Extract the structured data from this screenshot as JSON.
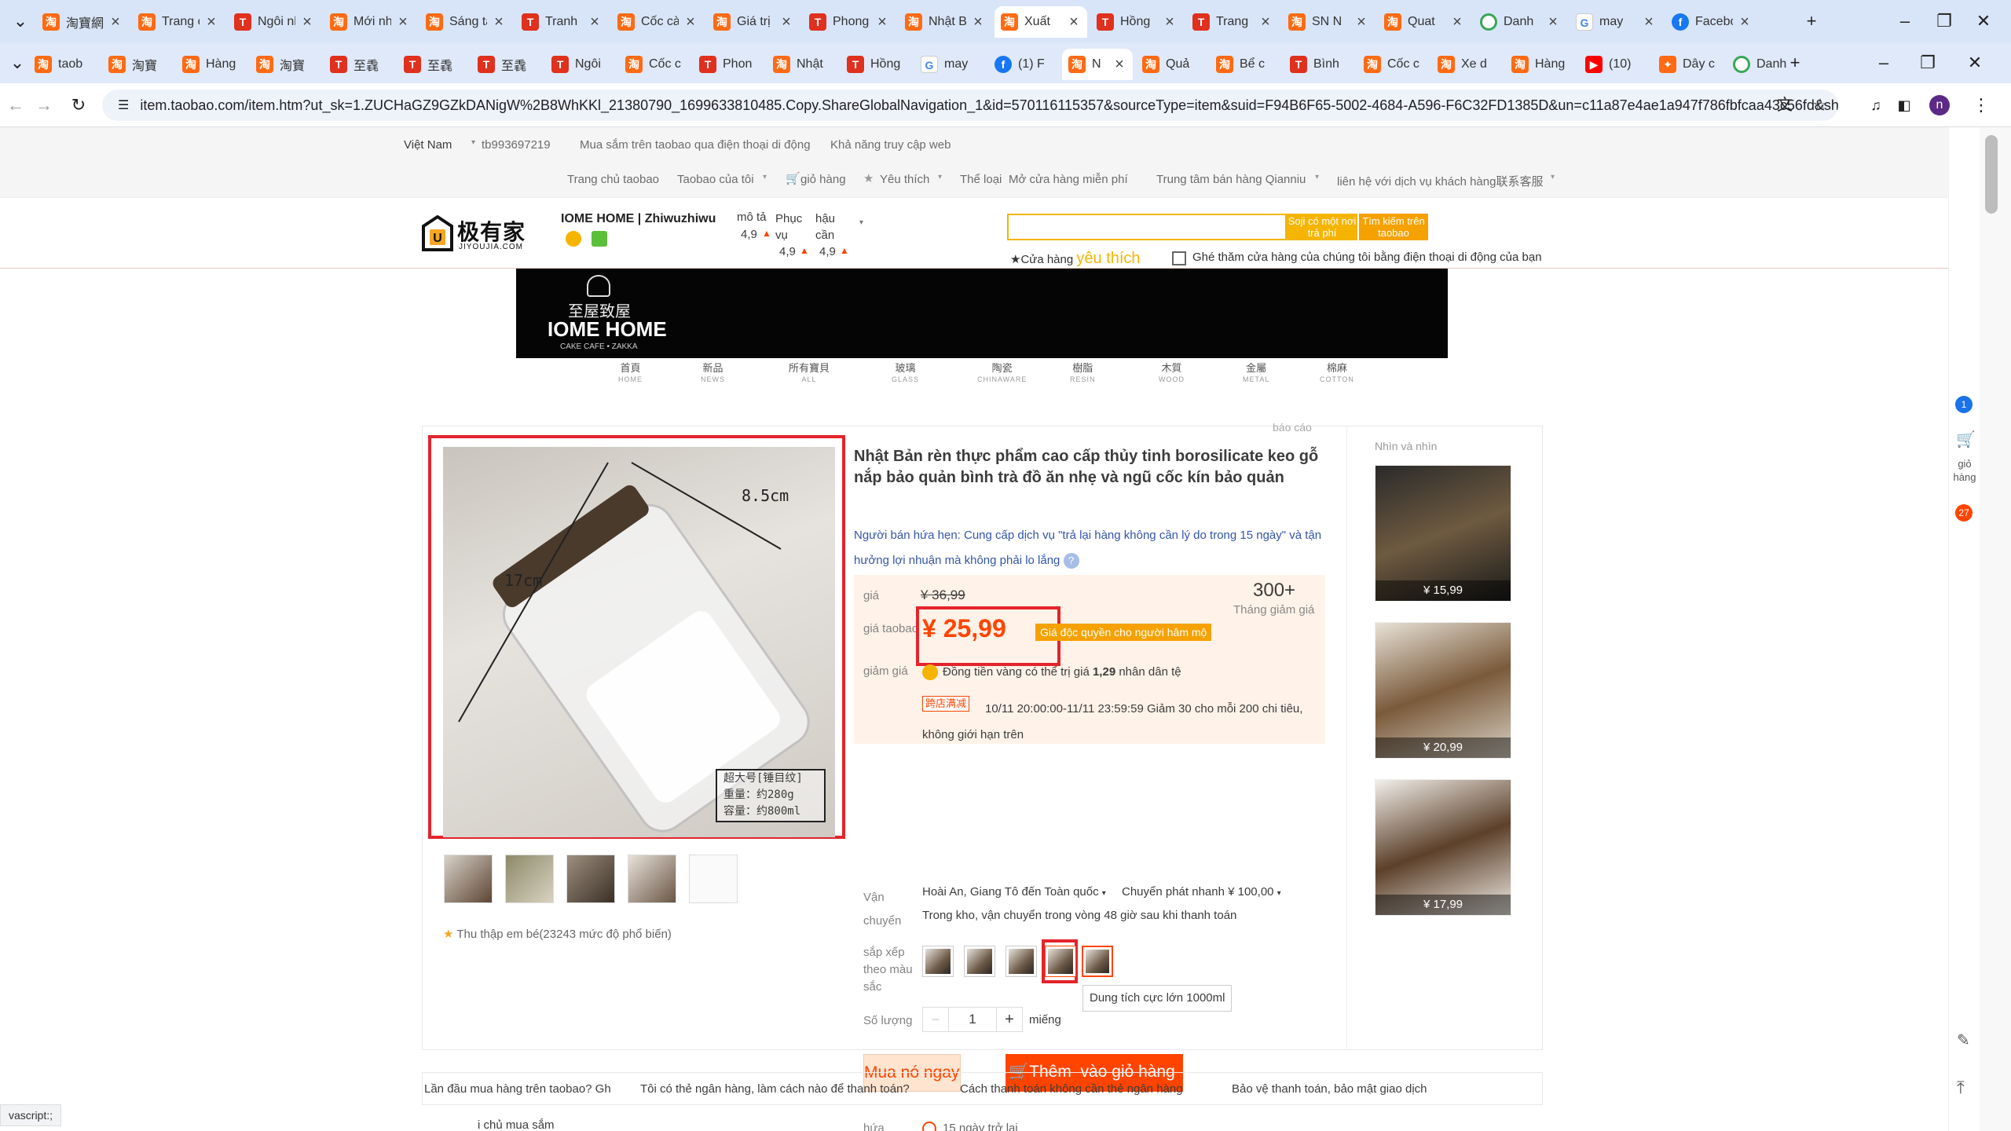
{
  "tabs_row1": [
    {
      "label": "淘寶網",
      "icon": "taobao-icon"
    },
    {
      "label": "Trang chủ",
      "icon": "taobao-icon"
    },
    {
      "label": "Ngôi nhà",
      "icon": "tmall-icon"
    },
    {
      "label": "Mới nhất",
      "icon": "taobao-icon"
    },
    {
      "label": "Sáng tạo",
      "icon": "taobao-icon"
    },
    {
      "label": "Tranh",
      "icon": "tmall-icon"
    },
    {
      "label": "Cốc cà phê",
      "icon": "taobao-icon"
    },
    {
      "label": "Giá trị",
      "icon": "taobao-icon"
    },
    {
      "label": "Phong cách",
      "icon": "tmall-icon"
    },
    {
      "label": "Nhật Bản",
      "icon": "taobao-icon"
    },
    {
      "label": "Xuất",
      "icon": "taobao-icon",
      "active": true
    },
    {
      "label": "Hồng",
      "icon": "tmall-icon"
    },
    {
      "label": "Trang",
      "icon": "tmall-icon"
    },
    {
      "label": "SN N",
      "icon": "taobao-icon"
    },
    {
      "label": "Quat",
      "icon": "taobao-icon"
    },
    {
      "label": "Danh",
      "icon": "chrome-icon"
    },
    {
      "label": "may",
      "icon": "google-icon"
    },
    {
      "label": "Facebook",
      "icon": "facebook-icon"
    }
  ],
  "tabs_row2": [
    {
      "label": "taob",
      "icon": "taobao-icon"
    },
    {
      "label": "淘寶",
      "icon": "taobao-icon"
    },
    {
      "label": "Hàng",
      "icon": "taobao-icon"
    },
    {
      "label": "淘寶",
      "icon": "taobao-icon"
    },
    {
      "label": "至毳",
      "icon": "tmall-icon"
    },
    {
      "label": "至毳",
      "icon": "tmall-icon"
    },
    {
      "label": "至毳",
      "icon": "tmall-icon"
    },
    {
      "label": "Ngôi",
      "icon": "tmall-icon"
    },
    {
      "label": "Cốc c",
      "icon": "taobao-icon"
    },
    {
      "label": "Phon",
      "icon": "tmall-icon"
    },
    {
      "label": "Nhật",
      "icon": "taobao-icon"
    },
    {
      "label": "Hồng",
      "icon": "tmall-icon"
    },
    {
      "label": "may",
      "icon": "google-icon"
    },
    {
      "label": "(1) F",
      "icon": "facebook-icon"
    },
    {
      "label": "N",
      "icon": "taobao-icon",
      "active": true
    },
    {
      "label": "Quả",
      "icon": "taobao-icon"
    },
    {
      "label": "Bể c",
      "icon": "taobao-icon"
    },
    {
      "label": "Bình",
      "icon": "tmall-icon"
    },
    {
      "label": "Cốc c",
      "icon": "taobao-icon"
    },
    {
      "label": "Xe d",
      "icon": "taobao-icon"
    },
    {
      "label": "Hàng",
      "icon": "taobao-icon"
    },
    {
      "label": "(10)",
      "icon": "youtube-icon"
    },
    {
      "label": "Dây c",
      "icon": "shopping-icon"
    },
    {
      "label": "Danh",
      "icon": "chrome-icon"
    }
  ],
  "address_url": "item.taobao.com/item.htm?ut_sk=1.ZUCHaGZ9GZkDANigW%2B8WhKKl_21380790_1699633810485.Copy.ShareGlobalNavigation_1&id=570116115357&sourceType=item&suid=F94B6F65-5002-4684-A596-F6C32FD1385D&un=c11a87e4ae1a947f786fbfcaa43c56fd&sh...",
  "profile_initial": "n",
  "topbar": {
    "region": "Việt Nam",
    "user": "tb993697219",
    "mobile": "Mua sắm trên taobao qua điện thoại di động",
    "accessibility": "Khả năng truy cập web",
    "home": "Trang chủ taobao",
    "my_taobao": "Taobao của tôi",
    "cart": "giỏ hàng",
    "favorites": "Yêu thích",
    "category": "Thể loại",
    "open_shop": "Mở cửa hàng miễn phí",
    "seller_center": "Trung tâm bán hàng Qianniu",
    "contact": "liên hệ với dịch vụ khách hàng联系客服"
  },
  "shop": {
    "logo_cn": "极有家",
    "logo_en": "JIYOUJIA.COM",
    "name": "IOME HOME | Zhiwuzhiwu",
    "rating_desc_label": "mô tả",
    "rating_desc": "4,9",
    "rating_service_label": "Phục vụ",
    "rating_service": "4,9",
    "rating_logistics_label": "hậu cần",
    "rating_logistics": "4,9",
    "search_placeholder": "",
    "search_all_btn": "Soji có một nơi trả phí",
    "search_taobao_btn": "Tìm kiếm trên taobao",
    "fav_store": "Cửa hàng",
    "fav_store_em": "yêu thích",
    "mobile_visit": "Ghé thăm cửa hàng của chúng tôi bằng điện thoại di động của bạn"
  },
  "banner": {
    "cn": "至屋致屋",
    "en": "IOME HOME",
    "sub": "CAKE CAFE • ZAKKA"
  },
  "nav_categories": [
    {
      "cn": "首頁",
      "en": "HOME"
    },
    {
      "cn": "新品",
      "en": "NEWS"
    },
    {
      "cn": "所有寶貝",
      "en": "ALL"
    },
    {
      "cn": "玻璃",
      "en": "GLASS"
    },
    {
      "cn": "陶瓷",
      "en": "CHINAWARE"
    },
    {
      "cn": "樹脂",
      "en": "RESIN"
    },
    {
      "cn": "木質",
      "en": "WOOD"
    },
    {
      "cn": "金屬",
      "en": "METAL"
    },
    {
      "cn": "棉麻",
      "en": "COTTON"
    }
  ],
  "product": {
    "report": "báo cáo",
    "title": "Nhật Bản rèn thực phẩm cao cấp thủy tinh borosilicate keo gỗ nắp bảo quản bình trà đồ ăn nhẹ và ngũ cốc kín bảo quản",
    "promise": "Người bán hứa hẹn: Cung cấp dịch vụ \"trả lại hàng không cần lý do trong 15 ngày\" và tận hưởng lợi nhuận mà không phải lo lắng",
    "image_dim_width": "8.5cm",
    "image_dim_height": "17cm",
    "image_spec_1": "超大号[锤目纹]",
    "image_spec_2": "重量：约280g",
    "image_spec_3": "容量：约800ml",
    "price_label": "giá",
    "price_original": "¥ 36,99",
    "monthly_count": "300+",
    "monthly_label": "Tháng giảm giá",
    "taobao_price_label": "giá taobao",
    "price_currency": "¥",
    "price_value": "25,99",
    "price_badge": "Giá độc quyền cho người hâm mộ",
    "discount_label": "giảm giá",
    "coin_text": "Đồng tiền vàng có thể trị giá",
    "coin_value": "1,29",
    "coin_suffix": "nhân dân tệ",
    "cross_store_tag": "跨店满减",
    "cross_store_text": "10/11 20:00:00-11/11 23:59:59 Giảm 30 cho mỗi 200 chi tiêu, không giới hạn trên",
    "shipping_label": "Vận chuyển",
    "shipping_route": "Hoài An, Giang Tô đến Toàn quốc",
    "shipping_method": "Chuyển phát nhanh ¥ 100,00",
    "shipping_note": "Trong kho, vận chuyển trong vòng 48 giờ sau khi thanh toán",
    "color_label": "sắp xếp theo màu sắc",
    "tooltip": "Dung tích cực lớn 1000ml",
    "qty_label": "Số lượng",
    "qty_value": "1",
    "qty_unit": "miếng",
    "buy_now": "Mua nó ngay bây",
    "add_cart_1": "Thêm",
    "add_cart_2": "vào giỏ hàng",
    "promise_label": "hứa",
    "return_policy": "15 ngày trở lại",
    "collect": "Thu thập em bé(23243 mức độ phổ biến)"
  },
  "side": {
    "heading": "Nhìn và nhìn",
    "items": [
      {
        "price": "¥ 15,99"
      },
      {
        "price": "¥ 20,99"
      },
      {
        "price": "¥ 17,99"
      }
    ]
  },
  "right_cart": {
    "label": "giỏ hàng",
    "count": "27",
    "badge": "1"
  },
  "bottom_links": [
    "Lần đầu mua hàng trên taobao? Gh",
    "Tôi có thẻ ngân hàng, làm cách nào để thanh toán?",
    "Cách thanh toán không cần thẻ ngân hàng",
    "Bảo vệ thanh toán, bảo mật giao dịch"
  ],
  "bottom_cut": "i chủ mua sắm",
  "status_bar": "vascript:;",
  "colors": {
    "accent": "#ff4400",
    "price": "#f40",
    "highlight": "#e3242b",
    "buy_bg": "#ffe4d0",
    "cart_bg": "#ff4400"
  }
}
